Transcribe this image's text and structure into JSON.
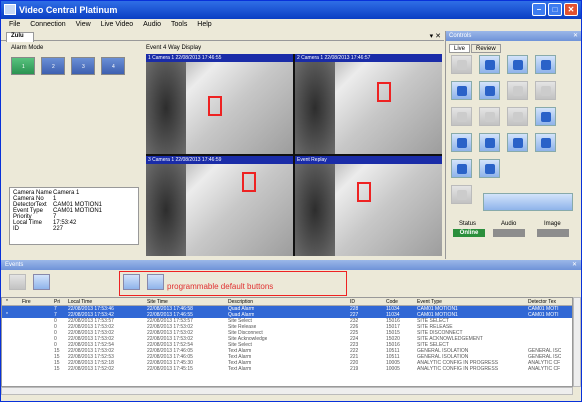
{
  "window": {
    "title": "Video Central Platinum"
  },
  "menu": [
    "File",
    "Connection",
    "View",
    "Live Video",
    "Audio",
    "Tools",
    "Help"
  ],
  "doc_tab": "Zulu",
  "alarm": {
    "label": "Alarm Mode",
    "buttons": [
      "1",
      "2",
      "3",
      "4"
    ]
  },
  "display": {
    "label": "Event 4 Way Display",
    "cams": [
      "1 Camera 1  22/08/2013 17:46:55",
      "2 Camera 1  22/08/2013 17:46:57",
      "3 Camera 1  22/08/2013 17:46:59",
      "Event Replay"
    ]
  },
  "info": [
    [
      "Camera Name",
      "Camera 1"
    ],
    [
      "Camera No",
      "1"
    ],
    [
      "DetectorText",
      "CAM01 MOTION1"
    ],
    [
      "Event Type",
      "CAM01 MOTION1"
    ],
    [
      "Priority",
      "7"
    ],
    [
      "Local Time",
      "17:53:42"
    ],
    [
      "ID",
      "227"
    ]
  ],
  "controls": {
    "title": "Controls",
    "tabs": [
      "Live",
      "Review"
    ],
    "status_labels": [
      "Status",
      "Audio",
      "Image"
    ],
    "status_value": "Online"
  },
  "events": {
    "title": "Events",
    "note": "programmable default buttons",
    "columns": [
      "*",
      "Fire",
      "Pri",
      "Local Time",
      "Site Time",
      "Description",
      "ID",
      "Code",
      "Event Type",
      "Detector Tex"
    ],
    "rows": [
      [
        "",
        "",
        "7",
        "22/08/2013 17:53:46",
        "22/08/2013 17:46:58",
        "Quad Alarm",
        "228",
        "11034",
        "CAM01 MOTION1",
        "CAM01 MOTI"
      ],
      [
        "*",
        "",
        "7",
        "22/08/2013 17:53:42",
        "22/08/2013 17:46:55",
        "Quad Alarm",
        "227",
        "11034",
        "CAM01 MOTION1",
        "CAM01 MOTI"
      ],
      [
        "",
        "",
        "0",
        "22/08/2013 17:53:57",
        "22/08/2013 17:53:57",
        "Site Select",
        "232",
        "15016",
        "SITE SELECT",
        ""
      ],
      [
        "",
        "",
        "0",
        "22/08/2013 17:53:02",
        "22/08/2013 17:53:02",
        "Site Release",
        "226",
        "15017",
        "SITE RELEASE",
        ""
      ],
      [
        "",
        "",
        "0",
        "22/08/2013 17:53:02",
        "22/08/2013 17:53:02",
        "Site Disconnect",
        "225",
        "15015",
        "SITE DISCONNECT",
        ""
      ],
      [
        "",
        "",
        "0",
        "22/08/2013 17:53:02",
        "22/08/2013 17:53:02",
        "Site Acknowledge",
        "224",
        "15020",
        "SITE ACKNOWLEDGEMENT",
        ""
      ],
      [
        "",
        "",
        "0",
        "22/08/2013 17:52:54",
        "22/08/2013 17:52:54",
        "Site Select",
        "223",
        "15016",
        "SITE SELECT",
        ""
      ],
      [
        "",
        "",
        "15",
        "22/08/2013 17:53:02",
        "22/08/2013 17:46:05",
        "Text Alarm",
        "222",
        "10511",
        "GENERAL ISOLATION",
        "GENERAL ISC"
      ],
      [
        "",
        "",
        "15",
        "22/08/2013 17:52:53",
        "22/08/2013 17:46:05",
        "Text Alarm",
        "221",
        "10511",
        "GENERAL ISOLATION",
        "GENERAL ISC"
      ],
      [
        "",
        "",
        "15",
        "22/08/2013 17:52:18",
        "22/08/2013 17:45:30",
        "Text Alarm",
        "220",
        "10005",
        "ANALYTIC CONFIG IN PROGRESS",
        "ANALYTIC CF"
      ],
      [
        "",
        "",
        "15",
        "22/08/2013 17:52:02",
        "22/08/2013 17:45:15",
        "Text Alarm",
        "219",
        "10005",
        "ANALYTIC CONFIG IN PROGRESS",
        "ANALYTIC CF"
      ]
    ]
  }
}
